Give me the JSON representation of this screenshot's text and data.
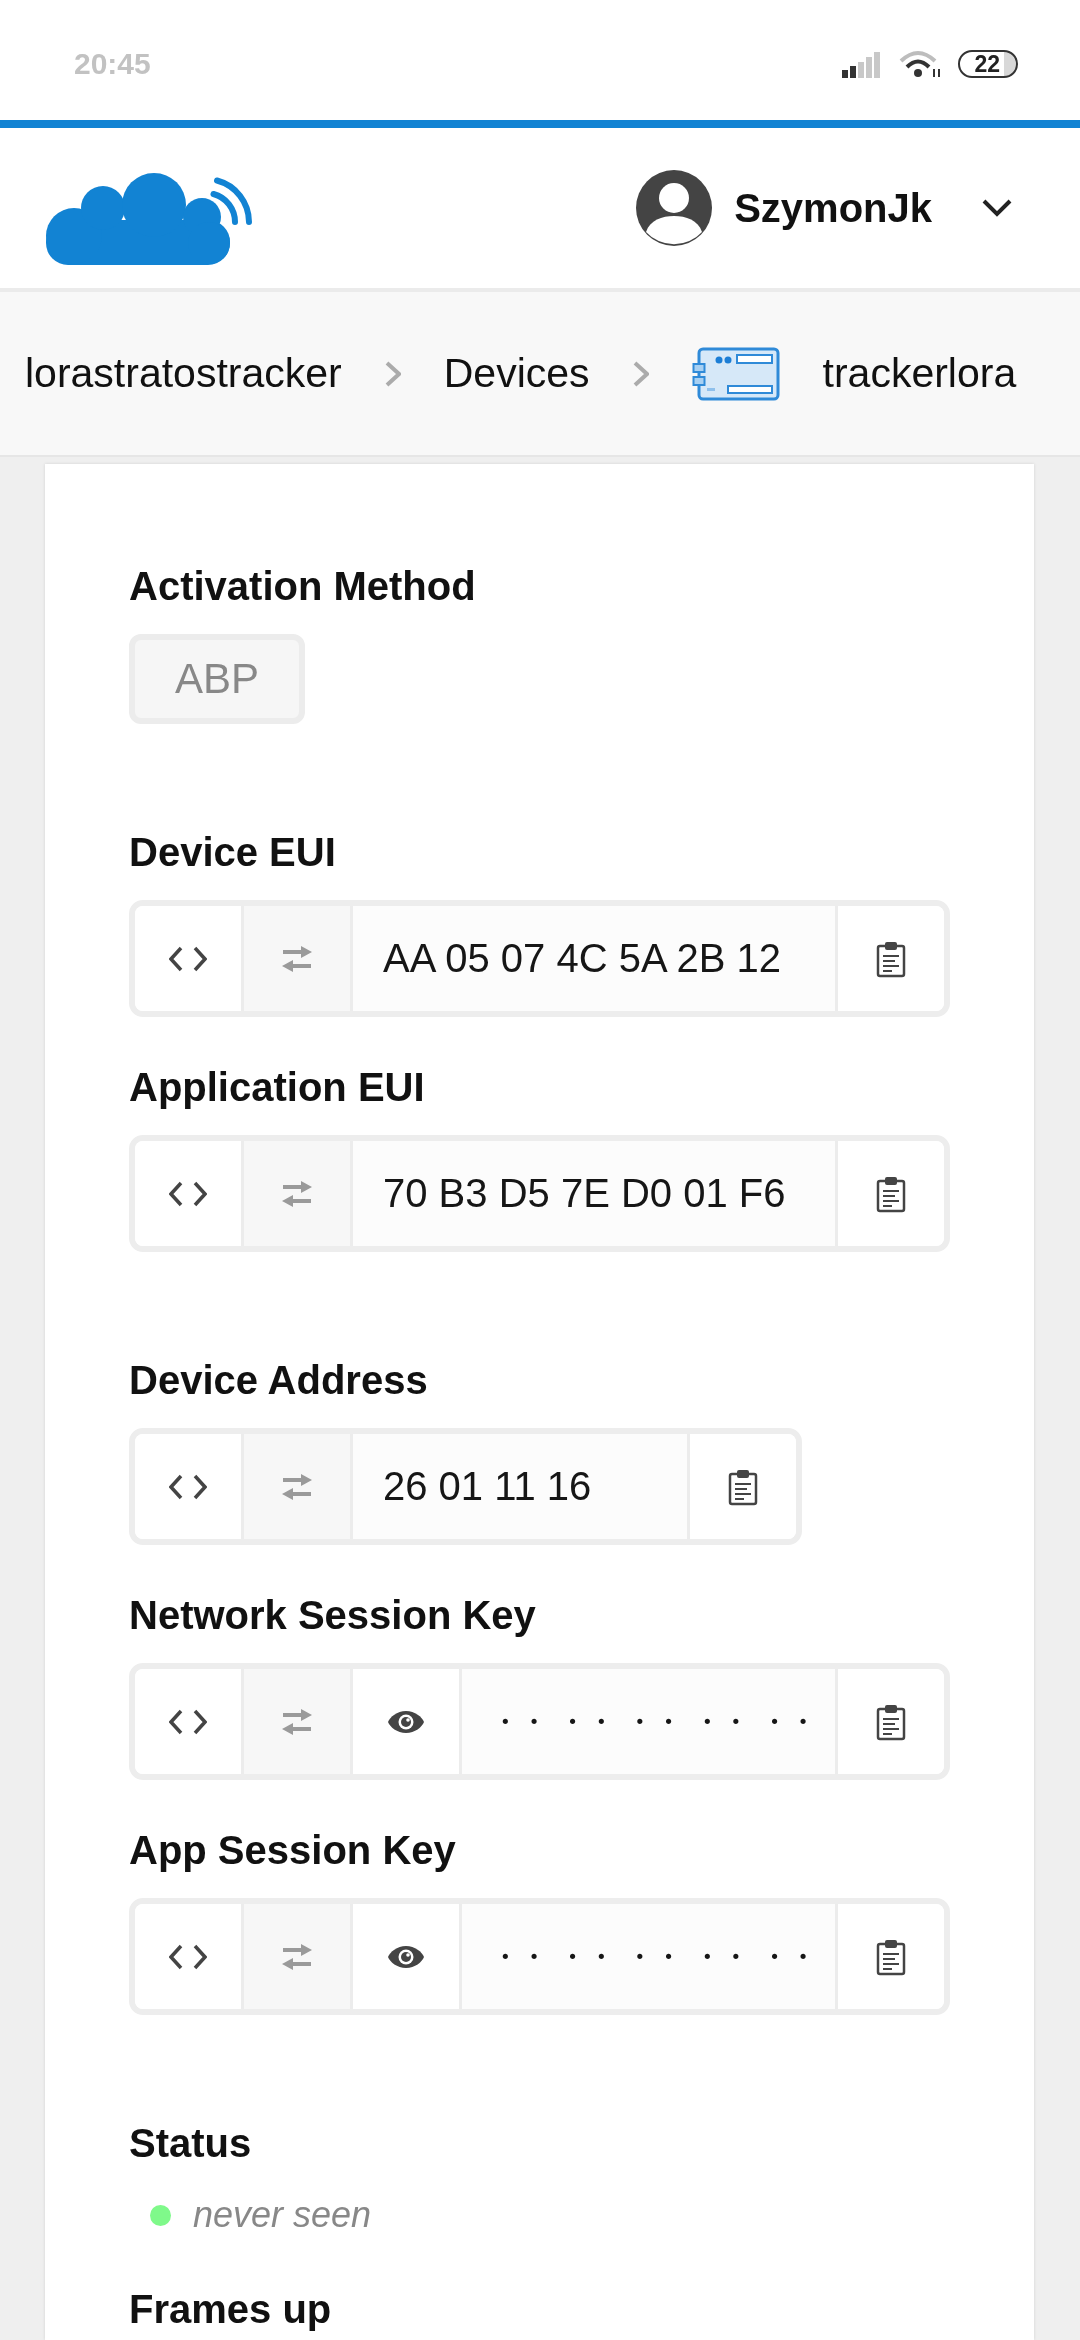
{
  "status_bar": {
    "time": "20:45",
    "battery": "22"
  },
  "header": {
    "user_name": "SzymonJk"
  },
  "breadcrumbs": [
    {
      "label": "lorastratostracker",
      "kind": "link"
    },
    {
      "label": "Devices",
      "kind": "link"
    },
    {
      "label": "trackerlora",
      "kind": "device"
    }
  ],
  "groups": [
    {
      "fields": [
        {
          "kind": "tag",
          "label": "Activation Method",
          "value": "ABP"
        }
      ]
    },
    {
      "fields": [
        {
          "kind": "hex",
          "label": "Device EUI",
          "value": "AA 05 07 4C 5A 2B 12"
        },
        {
          "kind": "hex",
          "label": "Application EUI",
          "value": "70 B3 D5 7E D0 01 F6"
        }
      ]
    },
    {
      "fields": [
        {
          "kind": "hex",
          "label": "Device Address",
          "value": "26 01 11 16"
        },
        {
          "kind": "secret",
          "label": "Network Session Key",
          "value": "·· ·· ·· ·· ··"
        },
        {
          "kind": "secret",
          "label": "App Session Key",
          "value": "·· ·· ·· ·· ··"
        }
      ]
    },
    {
      "fields": [
        {
          "kind": "status",
          "label": "Status",
          "value": "never seen",
          "color": "#7ff98a"
        },
        {
          "kind": "heading",
          "label": "Frames up"
        }
      ]
    }
  ]
}
